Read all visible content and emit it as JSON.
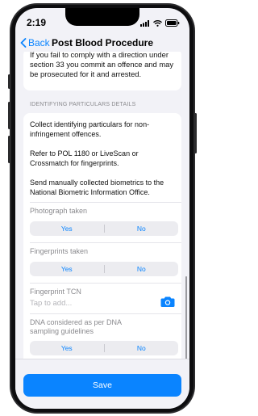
{
  "status_bar": {
    "time": "2:19"
  },
  "nav": {
    "back_label": "Back",
    "title": "Post Blood Procedure"
  },
  "warning": "If you fail to comply with a direction under section 33 you commit an offence and may be prosecuted for it and arrested.",
  "section": {
    "header": "IDENTIFYING PARTICULARS DETAILS",
    "paragraphs": [
      "Collect identifying particulars for non-infringement offences.",
      "Refer to POL 1180 or LiveScan or Crossmatch for fingerprints.",
      "Send manually collected biometrics to the National Biometric Information Office."
    ],
    "photograph": {
      "label": "Photograph taken",
      "options": [
        "Yes",
        "No"
      ]
    },
    "fingerprints": {
      "label": "Fingerprints taken",
      "options": [
        "Yes",
        "No"
      ]
    },
    "tcn": {
      "label": "Fingerprint TCN",
      "placeholder": "Tap to add..."
    },
    "dna": {
      "label": "DNA considered as per DNA sampling guidelines",
      "options": [
        "Yes",
        "No"
      ]
    }
  },
  "footer": {
    "save_label": "Save"
  },
  "colors": {
    "accent": "#0a84ff",
    "background": "#f2f2f7",
    "card": "#ffffff"
  },
  "icons": [
    "chevron-left-icon",
    "camera-icon",
    "signal-icon",
    "wifi-icon",
    "battery-icon"
  ]
}
